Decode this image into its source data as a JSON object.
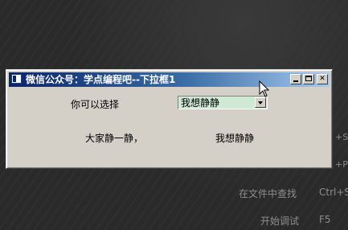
{
  "background": {
    "menu_items": [
      {
        "label": "在文件中查找",
        "shortcut": "Ctrl+S"
      },
      {
        "label": "开始调试",
        "shortcut": "F5"
      }
    ],
    "edge_texts": [
      "+S",
      "+P"
    ]
  },
  "window": {
    "title": "微信公众号：学点编程吧--下拉框1",
    "prompt_label": "你可以选择",
    "combo": {
      "selected": "我想静静"
    },
    "left_text": "大家静一静，",
    "right_text": "我想静静"
  },
  "colors": {
    "title_start": "#0a246a",
    "title_end": "#a6caf0",
    "window_face": "#d4d0c8",
    "combo_fill": "#cfe9d4"
  },
  "icons": [
    "app-icon",
    "minimize-icon",
    "maximize-icon",
    "close-icon",
    "mouse-cursor-icon"
  ]
}
